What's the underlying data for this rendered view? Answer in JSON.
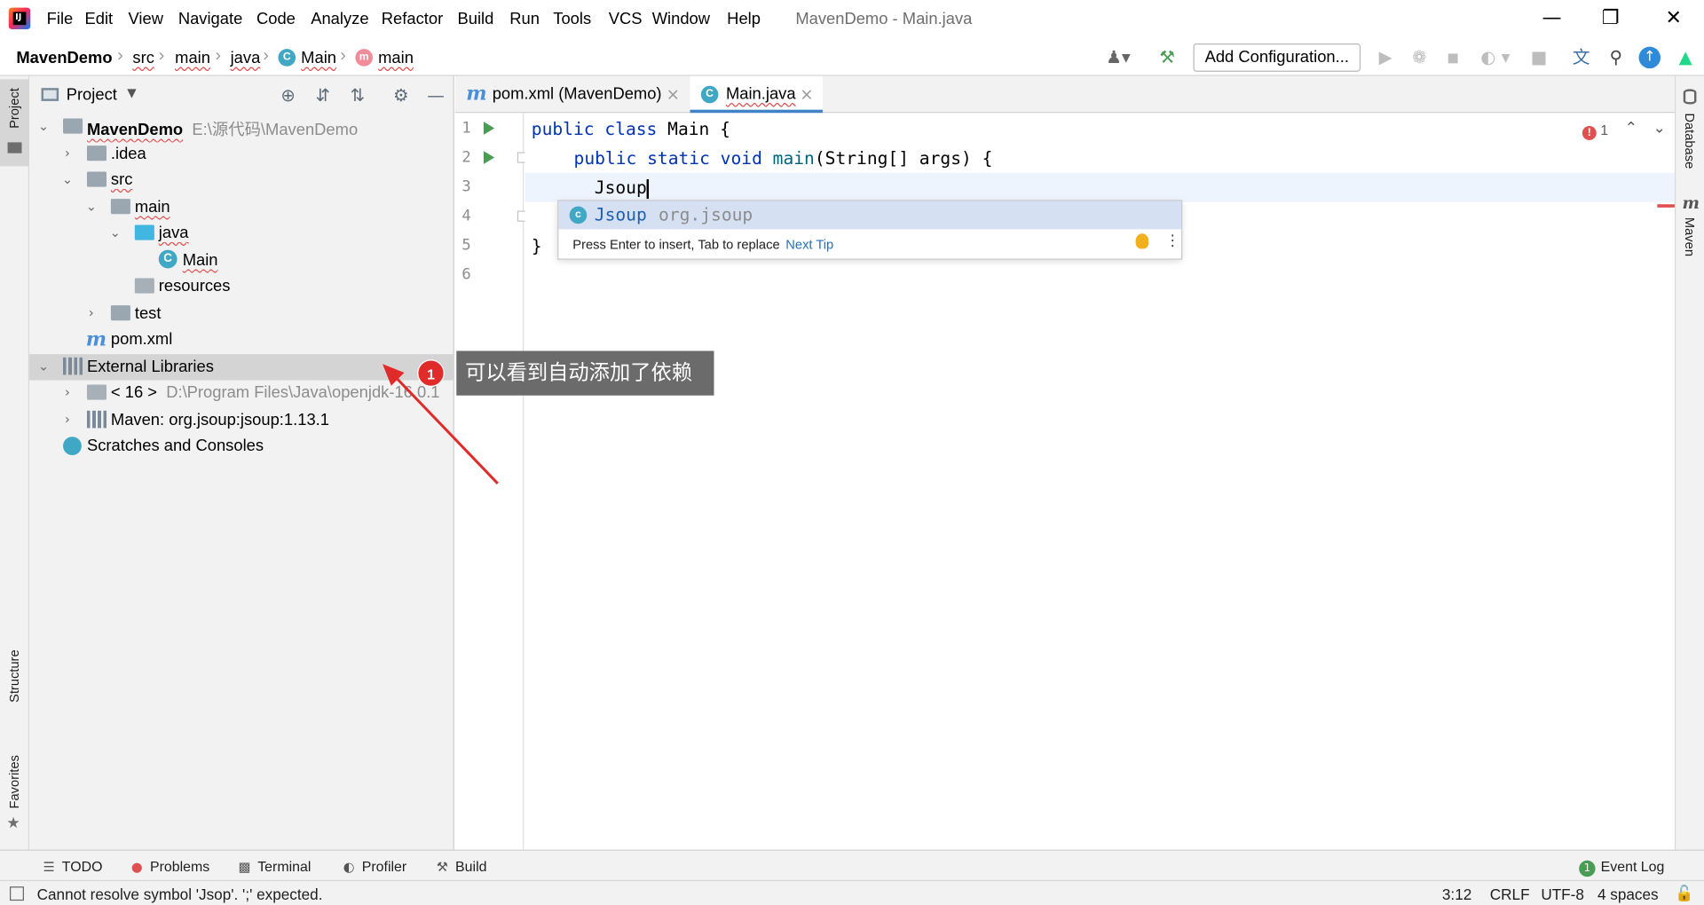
{
  "window": {
    "title": "MavenDemo - Main.java",
    "menu": [
      "File",
      "Edit",
      "View",
      "Navigate",
      "Code",
      "Analyze",
      "Refactor",
      "Build",
      "Run",
      "Tools",
      "VCS",
      "Window",
      "Help"
    ]
  },
  "breadcrumb": [
    "MavenDemo",
    "src",
    "main",
    "java",
    "Main",
    "main"
  ],
  "toolbar": {
    "add_configuration": "Add Configuration..."
  },
  "project_panel": {
    "title": "Project",
    "tree": [
      {
        "label": "MavenDemo",
        "path": "E:\\源代码\\MavenDemo",
        "icon": "module-folder-icon"
      },
      {
        "label": ".idea",
        "icon": "folder-icon"
      },
      {
        "label": "src",
        "icon": "folder-icon"
      },
      {
        "label": "main",
        "icon": "folder-icon"
      },
      {
        "label": "java",
        "icon": "source-folder-icon"
      },
      {
        "label": "Main",
        "icon": "class-icon"
      },
      {
        "label": "resources",
        "icon": "resources-folder-icon"
      },
      {
        "label": "test",
        "icon": "folder-icon"
      },
      {
        "label": "pom.xml",
        "icon": "maven-icon"
      },
      {
        "label": "External Libraries",
        "icon": "libraries-icon"
      },
      {
        "label": "< 16 >",
        "path": "D:\\Program Files\\Java\\openjdk-16.0.1",
        "icon": "jdk-icon"
      },
      {
        "label": "Maven: org.jsoup:jsoup:1.13.1",
        "icon": "library-icon"
      },
      {
        "label": "Scratches and Consoles",
        "icon": "scratches-icon"
      }
    ]
  },
  "editor": {
    "tabs": [
      {
        "label": "pom.xml (MavenDemo)",
        "icon": "maven-icon",
        "active": false
      },
      {
        "label": "Main.java",
        "icon": "class-icon",
        "active": true
      }
    ],
    "line_numbers": [
      "1",
      "2",
      "3",
      "4",
      "5",
      "6"
    ],
    "code": {
      "l1_kw1": "public",
      "l1_kw2": "class",
      "l1_name": "Main",
      "l1_rest": " {",
      "l2_kw1": "public",
      "l2_kw2": "static",
      "l2_kw3": "void",
      "l2_method": "main",
      "l2_rest": "(String[] args) {",
      "l3": "Jsoup",
      "l4": "",
      "l5": "}"
    },
    "error_count": "1"
  },
  "completion": {
    "name": "Jsoup",
    "package": "org.jsoup",
    "hint": "Press Enter to insert, Tab to replace",
    "next_tip": "Next Tip"
  },
  "annotation": {
    "badge": "1",
    "text": "可以看到自动添加了依赖"
  },
  "right_strip": [
    "Database",
    "Maven"
  ],
  "left_strip": [
    "Project",
    "Structure",
    "Favorites"
  ],
  "bottom_tools": [
    {
      "label": "TODO",
      "icon": "todo-icon"
    },
    {
      "label": "Problems",
      "icon": "problems-icon"
    },
    {
      "label": "Terminal",
      "icon": "terminal-icon"
    },
    {
      "label": "Profiler",
      "icon": "profiler-icon"
    },
    {
      "label": "Build",
      "icon": "hammer-icon"
    }
  ],
  "event_log": {
    "label": "Event Log",
    "count": "1"
  },
  "status": {
    "message": "Cannot resolve symbol 'Jsop'. ';' expected.",
    "position": "3:12",
    "line_sep": "CRLF",
    "encoding": "UTF-8",
    "indent": "4 spaces"
  },
  "colors": {
    "keyword": "#0033b3",
    "method": "#00627a",
    "accent": "#4083c9",
    "error": "#e05050",
    "callout_bg": "#6b6b6b",
    "badge_red": "#e02b2b"
  }
}
